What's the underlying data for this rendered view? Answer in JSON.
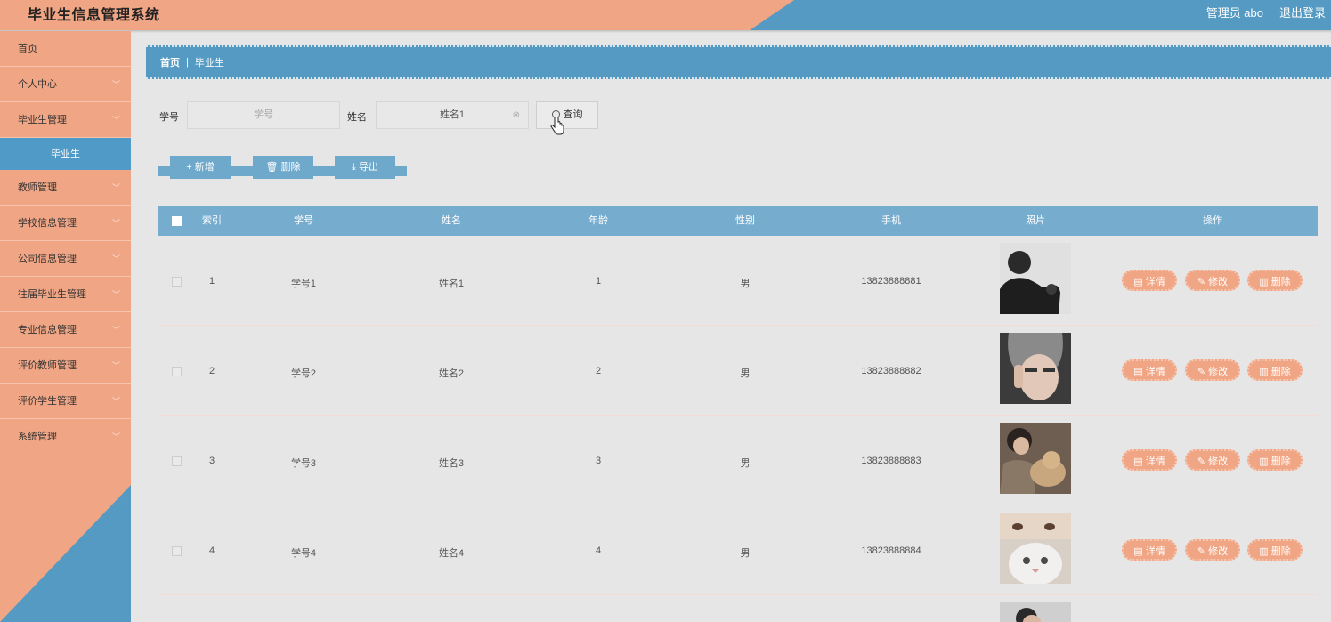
{
  "header": {
    "title": "毕业生信息管理系统",
    "admin": "管理员 abo",
    "logout": "退出登录"
  },
  "sidebar": {
    "items": [
      {
        "label": "首页",
        "chevron": false
      },
      {
        "label": "个人中心",
        "chevron": true
      },
      {
        "label": "毕业生管理",
        "chevron": true
      },
      {
        "label": "毕业生",
        "sub": true
      },
      {
        "label": "教师管理",
        "chevron": true
      },
      {
        "label": "学校信息管理",
        "chevron": true
      },
      {
        "label": "公司信息管理",
        "chevron": true
      },
      {
        "label": "往届毕业生管理",
        "chevron": true
      },
      {
        "label": "专业信息管理",
        "chevron": true
      },
      {
        "label": "评价教师管理",
        "chevron": true
      },
      {
        "label": "评价学生管理",
        "chevron": true
      },
      {
        "label": "系统管理",
        "chevron": true
      }
    ]
  },
  "breadcrumb": {
    "home": "首页",
    "separator": "|",
    "current": "毕业生"
  },
  "search": {
    "xuehao_label": "学号",
    "xuehao_placeholder": "学号",
    "xingming_label": "姓名",
    "xingming_value": "姓名1",
    "query_label": "查询"
  },
  "actions": {
    "add": "+ 新增",
    "delete": "删除",
    "export": "导出"
  },
  "table": {
    "columns": [
      "索引",
      "学号",
      "姓名",
      "年龄",
      "性别",
      "手机",
      "照片",
      "操作"
    ],
    "rows": [
      {
        "index": "1",
        "xuehao": "学号1",
        "xingming": "姓名1",
        "age": "1",
        "gender": "男",
        "phone": "13823888881"
      },
      {
        "index": "2",
        "xuehao": "学号2",
        "xingming": "姓名2",
        "age": "2",
        "gender": "男",
        "phone": "13823888882"
      },
      {
        "index": "3",
        "xuehao": "学号3",
        "xingming": "姓名3",
        "age": "3",
        "gender": "男",
        "phone": "13823888883"
      },
      {
        "index": "4",
        "xuehao": "学号4",
        "xingming": "姓名4",
        "age": "4",
        "gender": "男",
        "phone": "13823888884"
      }
    ],
    "row_actions": {
      "detail": "详情",
      "edit": "修改",
      "delete": "删除"
    }
  },
  "colors": {
    "salmon": "#f0a584",
    "blue": "#559ac3",
    "table_header": "#76adcf"
  }
}
